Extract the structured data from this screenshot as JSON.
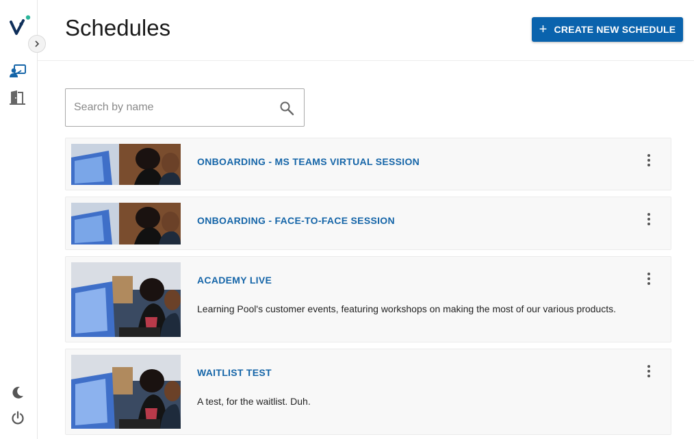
{
  "header": {
    "title": "Schedules",
    "create_button_label": "CREATE NEW SCHEDULE"
  },
  "search": {
    "placeholder": "Search by name",
    "value": ""
  },
  "sidebar": {
    "icons": [
      "logo",
      "expand-chevron-icon",
      "schedules-icon",
      "rooms-door-icon",
      "dark-mode-moon-icon",
      "power-logout-icon"
    ]
  },
  "colors": {
    "primary": "#0a63ad",
    "link": "#1565a8",
    "accent_dot": "#2bb59a",
    "card_bg": "#f8f8f8"
  },
  "schedules": [
    {
      "title": "ONBOARDING - MS TEAMS VIRTUAL SESSION",
      "description": ""
    },
    {
      "title": "ONBOARDING - FACE-TO-FACE SESSION",
      "description": ""
    },
    {
      "title": "ACADEMY LIVE",
      "description": "Learning Pool's customer events, featuring workshops on making the most of our various products."
    },
    {
      "title": "WAITLIST TEST",
      "description": "A test, for the waitlist. Duh."
    }
  ]
}
